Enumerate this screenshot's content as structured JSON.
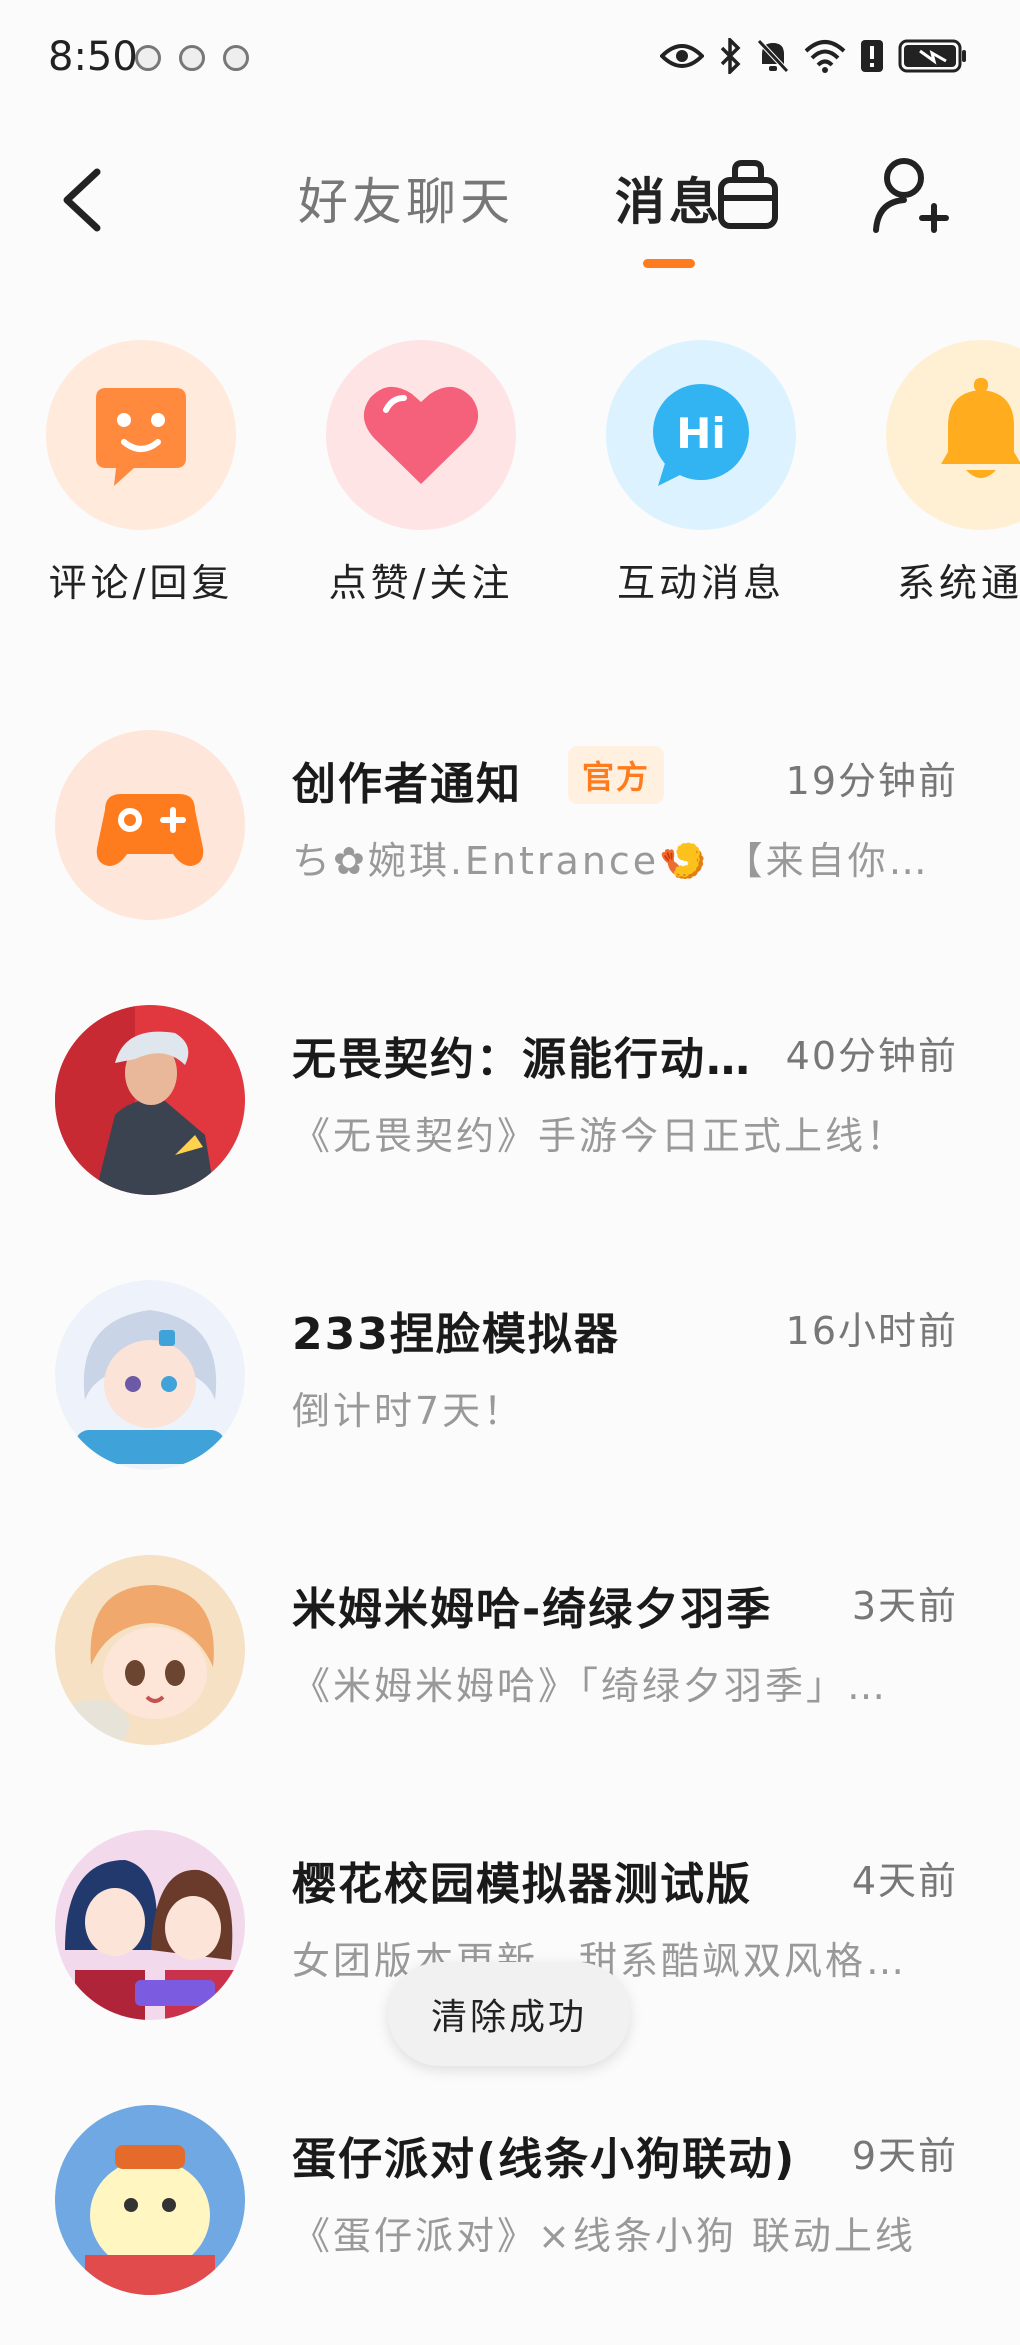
{
  "status_bar": {
    "time": "8:50"
  },
  "header": {
    "tabs": [
      {
        "label": "好友聊天"
      },
      {
        "label": "消息"
      }
    ]
  },
  "categories": [
    {
      "label": "评论/回复",
      "icon": "smile-chat-icon",
      "bg": "#ffeadc",
      "color": "#ff8a3d"
    },
    {
      "label": "点赞/关注",
      "icon": "heart-icon",
      "bg": "#ffe4e6",
      "color": "#f5607a"
    },
    {
      "label": "互动消息",
      "icon": "hi-bubble-icon",
      "bg": "#dcf3ff",
      "color": "#33b4f2"
    },
    {
      "label": "系统通知",
      "icon": "bell-icon",
      "bg": "#fff0d4",
      "color": "#ffad1f"
    }
  ],
  "messages": [
    {
      "title": "创作者通知",
      "badge": "官方",
      "time": "19分钟前",
      "preview": "ち✿婉琪.Entrance🍤 【来自你…"
    },
    {
      "title": "无畏契约：源能行动…",
      "time": "40分钟前",
      "preview": "《无畏契约》手游今日正式上线！"
    },
    {
      "title": "233捏脸模拟器",
      "time": "16小时前",
      "preview": "倒计时7天！"
    },
    {
      "title": "米姆米姆哈-绮绿夕羽季",
      "time": "3天前",
      "preview": "《米姆米姆哈》「绮绿夕羽季」…"
    },
    {
      "title": "樱花校园模拟器测试版",
      "time": "4天前",
      "preview": "女团版本更新，甜系酷飒双风格…"
    },
    {
      "title": "蛋仔派对(线条小狗联动)",
      "time": "9天前",
      "preview": "《蛋仔派对》×线条小狗 联动上线"
    }
  ],
  "toast": {
    "text": "清除成功"
  },
  "colors": {
    "accent": "#ff7c1e"
  }
}
